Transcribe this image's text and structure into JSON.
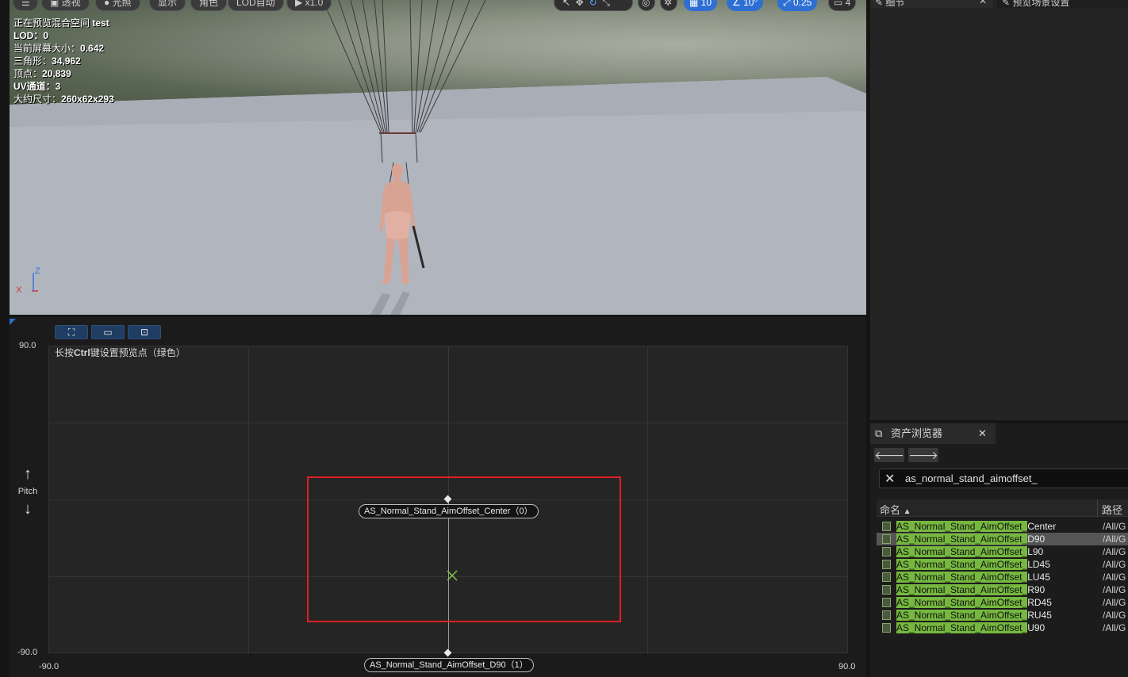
{
  "viewport": {
    "toolbar": {
      "menu_icon": "hamburger-icon",
      "perspective": "透视",
      "lighting": "光照",
      "show": "显示",
      "character": "角色",
      "lod": "LOD自动",
      "playback": "x1.0",
      "grid_value": "10",
      "angle_value": "10°",
      "scale_value": "0.25",
      "camera_speed": "4"
    },
    "stats": {
      "preview_label": "正在预览混合空间",
      "preview_name": "test",
      "lod_label": "LOD：",
      "lod_value": "0",
      "screen_size_label": "当前屏幕大小：",
      "screen_size_value": "0.642",
      "triangles_label": "三角形：",
      "triangles_value": "34,962",
      "vertices_label": "顶点：",
      "vertices_value": "20,839",
      "uv_label": "UV通道：",
      "uv_value": "3",
      "size_label": "大约尺寸：",
      "size_value": "260x62x293"
    },
    "axis_labels": {
      "x": "X",
      "z": "Z"
    }
  },
  "blend_space": {
    "hint_prefix": "长按",
    "hint_key": "Ctrl",
    "hint_suffix": "键设置预览点（绿色）",
    "y_max": "90.0",
    "y_min": "-90.0",
    "x_min": "-90.0",
    "x_max": "90.0",
    "axis_name": "Pitch",
    "samples": [
      {
        "label": "AS_Normal_Stand_AimOffset_Center（0）"
      },
      {
        "label": "AS_Normal_Stand_AimOffset_D90（1）"
      }
    ],
    "highlight_color": "#e02020",
    "preview_color": "#7ec83e"
  },
  "details": {
    "tab_details": "细节",
    "tab_scene": "预览场景设置"
  },
  "asset_browser": {
    "tab_label": "资产浏览器",
    "search_value": "as_normal_stand_aimoffset_",
    "col_name": "命名",
    "col_path": "路径",
    "highlight_prefix": "AS_Normal_Stand_AimOffset_",
    "assets": [
      {
        "suffix": "Center",
        "path": "/All/G"
      },
      {
        "suffix": "D90",
        "path": "/All/G"
      },
      {
        "suffix": "L90",
        "path": "/All/G"
      },
      {
        "suffix": "LD45",
        "path": "/All/G"
      },
      {
        "suffix": "LU45",
        "path": "/All/G"
      },
      {
        "suffix": "R90",
        "path": "/All/G"
      },
      {
        "suffix": "RD45",
        "path": "/All/G"
      },
      {
        "suffix": "RU45",
        "path": "/All/G"
      },
      {
        "suffix": "U90",
        "path": "/All/G"
      }
    ]
  }
}
